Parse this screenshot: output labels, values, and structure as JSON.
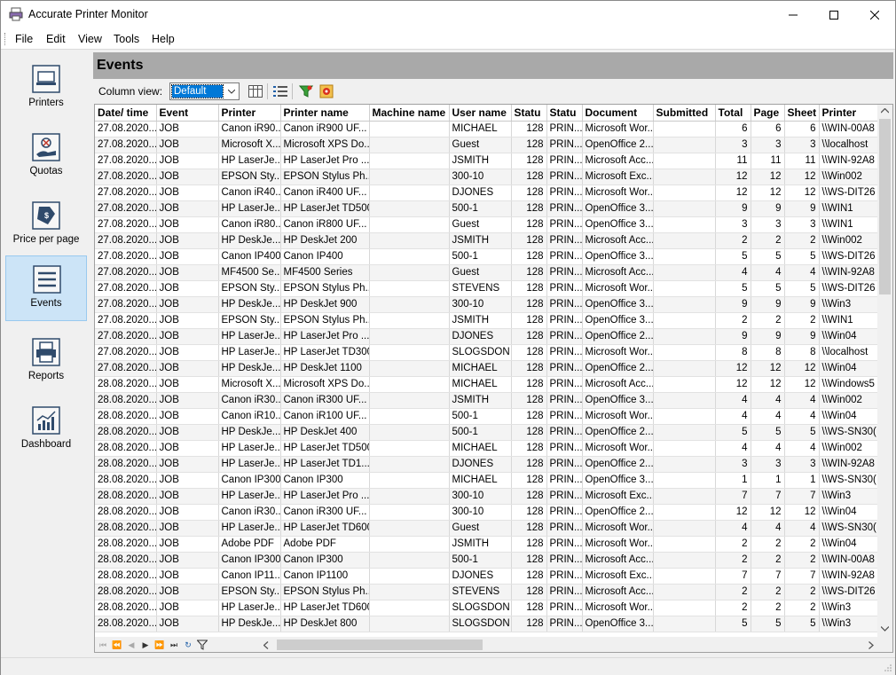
{
  "window": {
    "title": "Accurate Printer Monitor"
  },
  "menu": [
    "File",
    "Edit",
    "View",
    "Tools",
    "Help"
  ],
  "sidebar": {
    "items": [
      {
        "label": "Printers",
        "icon": "printers-icon"
      },
      {
        "label": "Quotas",
        "icon": "quotas-icon"
      },
      {
        "label": "Price per page",
        "icon": "price-tag-icon"
      },
      {
        "label": "Events",
        "icon": "events-list-icon",
        "active": true
      },
      {
        "label": "Reports",
        "icon": "reports-icon"
      },
      {
        "label": "Dashboard",
        "icon": "dashboard-chart-icon"
      }
    ]
  },
  "main": {
    "title": "Events",
    "column_view_label": "Column view:",
    "column_view_value": "Default"
  },
  "table": {
    "columns": [
      "Date/ time",
      "Event",
      "Printer",
      "Printer name",
      "Machine name",
      "User name",
      "Statu",
      "Statu",
      "Document",
      "Submitted",
      "Total",
      "Page",
      "Sheet",
      "Printer"
    ],
    "rows": [
      [
        "27.08.2020...",
        "JOB",
        "Canon iR90...",
        "Canon iR900 UF...",
        "",
        "MICHAEL",
        "128",
        "PRIN...",
        "Microsoft Wor...",
        "",
        "6",
        "6",
        "6",
        "\\\\WIN-00A8"
      ],
      [
        "27.08.2020...",
        "JOB",
        "Microsoft X...",
        "Microsoft XPS Do...",
        "",
        "Guest",
        "128",
        "PRIN...",
        "OpenOffice 2....",
        "",
        "3",
        "3",
        "3",
        "\\\\localhost"
      ],
      [
        "27.08.2020...",
        "JOB",
        "HP LaserJe...",
        "HP LaserJet Pro ...",
        "",
        "JSMITH",
        "128",
        "PRIN...",
        "Microsoft Acc...",
        "",
        "11",
        "11",
        "11",
        "\\\\WIN-92A8"
      ],
      [
        "27.08.2020...",
        "JOB",
        "EPSON Sty...",
        "EPSON Stylus Ph...",
        "",
        "300-10",
        "128",
        "PRIN...",
        "Microsoft Exc...",
        "",
        "12",
        "12",
        "12",
        "\\\\Win002"
      ],
      [
        "27.08.2020...",
        "JOB",
        "Canon iR40...",
        "Canon iR400 UF...",
        "",
        "DJONES",
        "128",
        "PRIN...",
        "Microsoft Wor...",
        "",
        "12",
        "12",
        "12",
        "\\\\WS-DIT26"
      ],
      [
        "27.08.2020...",
        "JOB",
        "HP LaserJe...",
        "HP LaserJet TD500",
        "",
        "500-1",
        "128",
        "PRIN...",
        "OpenOffice 3....",
        "",
        "9",
        "9",
        "9",
        "\\\\WIN1"
      ],
      [
        "27.08.2020...",
        "JOB",
        "Canon iR80...",
        "Canon iR800 UF...",
        "",
        "Guest",
        "128",
        "PRIN...",
        "OpenOffice 3....",
        "",
        "3",
        "3",
        "3",
        "\\\\WIN1"
      ],
      [
        "27.08.2020...",
        "JOB",
        "HP DeskJe...",
        "HP DeskJet 200",
        "",
        "JSMITH",
        "128",
        "PRIN...",
        "Microsoft Acc...",
        "",
        "2",
        "2",
        "2",
        "\\\\Win002"
      ],
      [
        "27.08.2020...",
        "JOB",
        "Canon IP400",
        "Canon IP400",
        "",
        "500-1",
        "128",
        "PRIN...",
        "OpenOffice 3....",
        "",
        "5",
        "5",
        "5",
        "\\\\WS-DIT26"
      ],
      [
        "27.08.2020...",
        "JOB",
        "MF4500 Se...",
        "MF4500 Series",
        "",
        "Guest",
        "128",
        "PRIN...",
        "Microsoft Acc...",
        "",
        "4",
        "4",
        "4",
        "\\\\WIN-92A8"
      ],
      [
        "27.08.2020...",
        "JOB",
        "EPSON Sty...",
        "EPSON Stylus Ph...",
        "",
        "STEVENS",
        "128",
        "PRIN...",
        "Microsoft Wor...",
        "",
        "5",
        "5",
        "5",
        "\\\\WS-DIT26"
      ],
      [
        "27.08.2020...",
        "JOB",
        "HP DeskJe...",
        "HP DeskJet 900",
        "",
        "300-10",
        "128",
        "PRIN...",
        "OpenOffice 3....",
        "",
        "9",
        "9",
        "9",
        "\\\\Win3"
      ],
      [
        "27.08.2020...",
        "JOB",
        "EPSON Sty...",
        "EPSON Stylus Ph...",
        "",
        "JSMITH",
        "128",
        "PRIN...",
        "OpenOffice 3....",
        "",
        "2",
        "2",
        "2",
        "\\\\WIN1"
      ],
      [
        "27.08.2020...",
        "JOB",
        "HP LaserJe...",
        "HP LaserJet Pro ...",
        "",
        "DJONES",
        "128",
        "PRIN...",
        "OpenOffice 2....",
        "",
        "9",
        "9",
        "9",
        "\\\\Win04"
      ],
      [
        "27.08.2020...",
        "JOB",
        "HP LaserJe...",
        "HP LaserJet TD300",
        "",
        "SLOGSDON",
        "128",
        "PRIN...",
        "Microsoft Wor...",
        "",
        "8",
        "8",
        "8",
        "\\\\localhost"
      ],
      [
        "27.08.2020...",
        "JOB",
        "HP DeskJe...",
        "HP DeskJet 1100",
        "",
        "MICHAEL",
        "128",
        "PRIN...",
        "OpenOffice 2....",
        "",
        "12",
        "12",
        "12",
        "\\\\Win04"
      ],
      [
        "28.08.2020...",
        "JOB",
        "Microsoft X...",
        "Microsoft XPS Do...",
        "",
        "MICHAEL",
        "128",
        "PRIN...",
        "Microsoft Acc...",
        "",
        "12",
        "12",
        "12",
        "\\\\Windows5"
      ],
      [
        "28.08.2020...",
        "JOB",
        "Canon iR30...",
        "Canon iR300 UF...",
        "",
        "JSMITH",
        "128",
        "PRIN...",
        "OpenOffice 3....",
        "",
        "4",
        "4",
        "4",
        "\\\\Win002"
      ],
      [
        "28.08.2020...",
        "JOB",
        "Canon iR10...",
        "Canon iR100 UF...",
        "",
        "500-1",
        "128",
        "PRIN...",
        "Microsoft Wor...",
        "",
        "4",
        "4",
        "4",
        "\\\\Win04"
      ],
      [
        "28.08.2020...",
        "JOB",
        "HP DeskJe...",
        "HP DeskJet 400",
        "",
        "500-1",
        "128",
        "PRIN...",
        "OpenOffice 2....",
        "",
        "5",
        "5",
        "5",
        "\\\\WS-SN30("
      ],
      [
        "28.08.2020...",
        "JOB",
        "HP LaserJe...",
        "HP LaserJet TD500",
        "",
        "MICHAEL",
        "128",
        "PRIN...",
        "Microsoft Wor...",
        "",
        "4",
        "4",
        "4",
        "\\\\Win002"
      ],
      [
        "28.08.2020...",
        "JOB",
        "HP LaserJe...",
        "HP LaserJet TD1...",
        "",
        "DJONES",
        "128",
        "PRIN...",
        "OpenOffice 2....",
        "",
        "3",
        "3",
        "3",
        "\\\\WIN-92A8"
      ],
      [
        "28.08.2020...",
        "JOB",
        "Canon IP300",
        "Canon IP300",
        "",
        "MICHAEL",
        "128",
        "PRIN...",
        "OpenOffice 3....",
        "",
        "1",
        "1",
        "1",
        "\\\\WS-SN30("
      ],
      [
        "28.08.2020...",
        "JOB",
        "HP LaserJe...",
        "HP LaserJet Pro ...",
        "",
        "300-10",
        "128",
        "PRIN...",
        "Microsoft Exc...",
        "",
        "7",
        "7",
        "7",
        "\\\\Win3"
      ],
      [
        "28.08.2020...",
        "JOB",
        "Canon iR30...",
        "Canon iR300 UF...",
        "",
        "300-10",
        "128",
        "PRIN...",
        "OpenOffice 2....",
        "",
        "12",
        "12",
        "12",
        "\\\\Win04"
      ],
      [
        "28.08.2020...",
        "JOB",
        "HP LaserJe...",
        "HP LaserJet TD600",
        "",
        "Guest",
        "128",
        "PRIN...",
        "Microsoft Wor...",
        "",
        "4",
        "4",
        "4",
        "\\\\WS-SN30("
      ],
      [
        "28.08.2020...",
        "JOB",
        "Adobe PDF",
        "Adobe PDF",
        "",
        "JSMITH",
        "128",
        "PRIN...",
        "Microsoft Wor...",
        "",
        "2",
        "2",
        "2",
        "\\\\Win04"
      ],
      [
        "28.08.2020...",
        "JOB",
        "Canon IP300",
        "Canon IP300",
        "",
        "500-1",
        "128",
        "PRIN...",
        "Microsoft Acc...",
        "",
        "2",
        "2",
        "2",
        "\\\\WIN-00A8"
      ],
      [
        "28.08.2020...",
        "JOB",
        "Canon IP11...",
        "Canon IP1100",
        "",
        "DJONES",
        "128",
        "PRIN...",
        "Microsoft Exc...",
        "",
        "7",
        "7",
        "7",
        "\\\\WIN-92A8"
      ],
      [
        "28.08.2020...",
        "JOB",
        "EPSON Sty...",
        "EPSON Stylus Ph...",
        "",
        "STEVENS",
        "128",
        "PRIN...",
        "Microsoft Acc...",
        "",
        "2",
        "2",
        "2",
        "\\\\WS-DIT26"
      ],
      [
        "28.08.2020...",
        "JOB",
        "HP LaserJe...",
        "HP LaserJet TD600",
        "",
        "SLOGSDON",
        "128",
        "PRIN...",
        "Microsoft Wor...",
        "",
        "2",
        "2",
        "2",
        "\\\\Win3"
      ],
      [
        "28.08.2020...",
        "JOB",
        "HP DeskJe...",
        "HP DeskJet 800",
        "",
        "SLOGSDON",
        "128",
        "PRIN...",
        "OpenOffice 3....",
        "",
        "5",
        "5",
        "5",
        "\\\\Win3"
      ]
    ]
  },
  "colors": {
    "header_bar": "#a9a9a9",
    "active_nav": "#cce4f7",
    "selection": "#0078d7"
  }
}
